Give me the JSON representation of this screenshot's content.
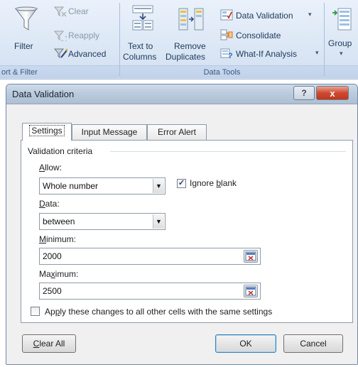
{
  "ribbon": {
    "sort_filter": {
      "filter_label": "Filter",
      "clear_label": "Clear",
      "reapply_label": "Reapply",
      "advanced_label": "Advanced",
      "group_label": "ort & Filter"
    },
    "data_tools": {
      "text_to_columns_line1": "Text to",
      "text_to_columns_line2": "Columns",
      "remove_duplicates_line1": "Remove",
      "remove_duplicates_line2": "Duplicates",
      "data_validation_label": "Data Validation",
      "consolidate_label": "Consolidate",
      "what_if_label": "What-If Analysis",
      "group_label": "Data Tools"
    },
    "outline": {
      "group_label": "Group"
    }
  },
  "dialog": {
    "title": "Data Validation",
    "help_glyph": "?",
    "close_glyph": "x",
    "tabs": [
      {
        "label": "Settings",
        "active": true
      },
      {
        "label": "Input Message",
        "active": false
      },
      {
        "label": "Error Alert",
        "active": false
      }
    ],
    "group_title": "Validation criteria",
    "allow": {
      "label_pre": "",
      "label_key": "A",
      "label_post": "llow:",
      "value": "Whole number"
    },
    "ignore_blank": {
      "checked": true,
      "label_pre": "Ignore ",
      "label_key": "b",
      "label_post": "lank"
    },
    "data": {
      "label_pre": "",
      "label_key": "D",
      "label_post": "ata:",
      "value": "between"
    },
    "minimum": {
      "label_pre": "",
      "label_key": "M",
      "label_post": "inimum:",
      "value": "2000"
    },
    "maximum": {
      "label_pre": "Ma",
      "label_key": "x",
      "label_post": "imum:",
      "value": "2500"
    },
    "apply_all": {
      "checked": false,
      "label_pre": "Ap",
      "label_key": "p",
      "label_post": "ly these changes to all other cells with the same settings"
    },
    "buttons": {
      "clear_all_pre": "",
      "clear_all_key": "C",
      "clear_all_post": "lear All",
      "ok": "OK",
      "cancel": "Cancel"
    }
  },
  "colors": {
    "ribbon_bg": "#dce7f5",
    "ribbon_text": "#1e395b",
    "dialog_bg": "#f0f0f0",
    "close_red": "#cd4a2f",
    "check_blue": "#1f3f7a"
  },
  "icons": [
    "filter-funnel-icon",
    "clear-filter-icon",
    "reapply-icon",
    "advanced-filter-icon",
    "text-to-columns-icon",
    "remove-duplicates-icon",
    "data-validation-icon",
    "consolidate-icon",
    "what-if-analysis-icon",
    "group-icon",
    "range-picker-icon",
    "chevron-down-icon",
    "checkmark-icon"
  ]
}
